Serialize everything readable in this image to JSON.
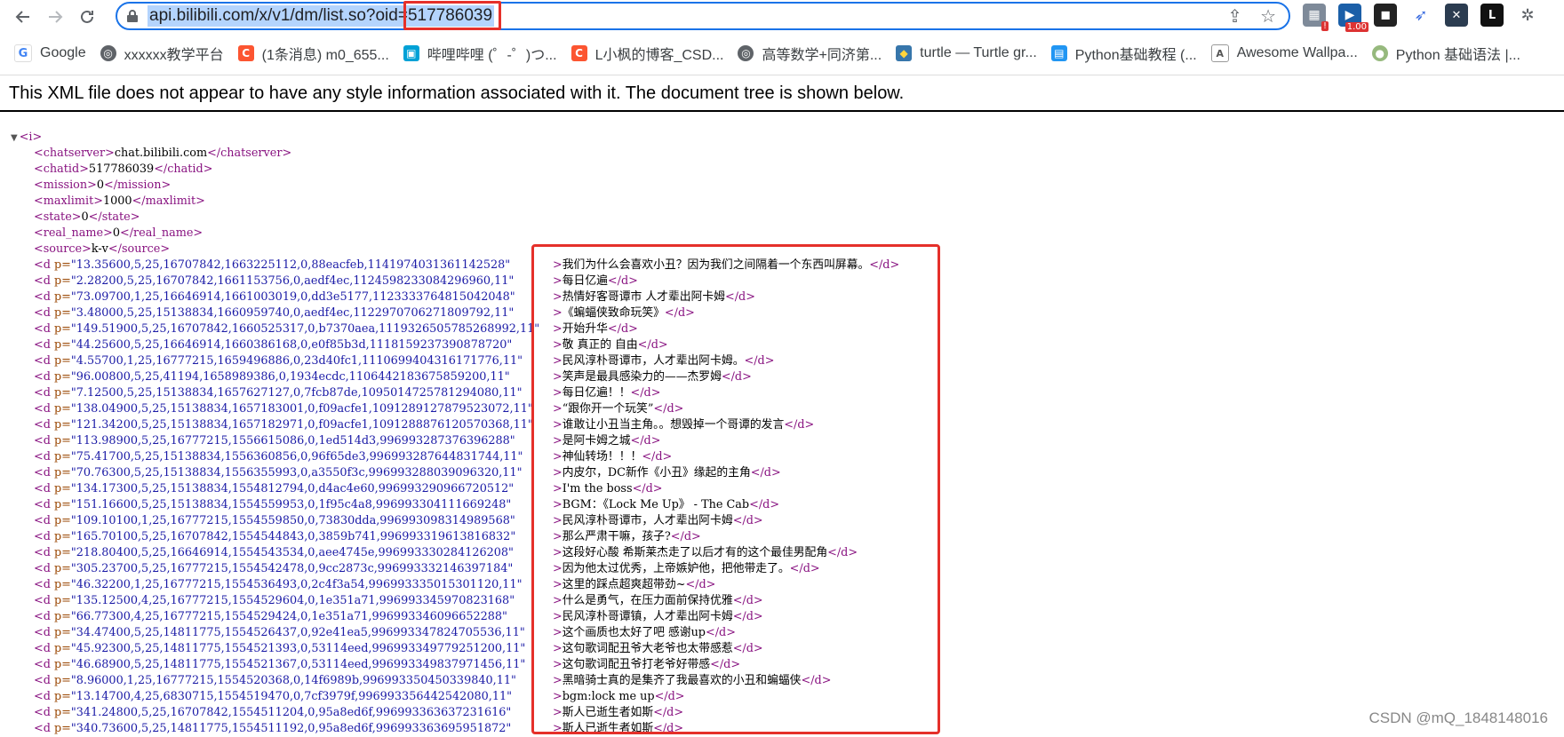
{
  "browser": {
    "url_base": "api.bilibili.com/x/v1/dm/list.so?oid=",
    "url_oid": "517786039",
    "extension_badges": [
      "!",
      "1.00"
    ],
    "bookmarks": [
      {
        "label": "Google",
        "icon": "google-icon",
        "color": "#4285f4"
      },
      {
        "label": "xxxxxx教学平台",
        "icon": "globe-icon",
        "color": "#5f6368"
      },
      {
        "label": "(1条消息) m0_655...",
        "icon": "csdn-icon",
        "color": "#fc5531"
      },
      {
        "label": "哔哩哔哩 (゜-゜)つ...",
        "icon": "bilibili-icon",
        "color": "#00a1d6"
      },
      {
        "label": "L小枫的博客_CSD...",
        "icon": "csdn-icon",
        "color": "#fc5531"
      },
      {
        "label": "高等数学+同济第...",
        "icon": "globe-icon",
        "color": "#5f6368"
      },
      {
        "label": "turtle — Turtle gr...",
        "icon": "python-icon",
        "color": "#3776ab"
      },
      {
        "label": "Python基础教程 (...",
        "icon": "runoob-icon",
        "color": "#2196f3"
      },
      {
        "label": "Awesome Wallpa...",
        "icon": "wallpaper-icon",
        "color": "#555555"
      },
      {
        "label": "Python 基础语法 |...",
        "icon": "runoob-green-icon",
        "color": "#96b97d"
      }
    ]
  },
  "xml": {
    "header": "This XML file does not appear to have any style information associated with it. The document tree is shown below.",
    "root_open": "<i>",
    "meta": [
      {
        "tag": "chatserver",
        "value": "chat.bilibili.com"
      },
      {
        "tag": "chatid",
        "value": "517786039"
      },
      {
        "tag": "mission",
        "value": "0"
      },
      {
        "tag": "maxlimit",
        "value": "1000"
      },
      {
        "tag": "state",
        "value": "0"
      },
      {
        "tag": "real_name",
        "value": "0"
      },
      {
        "tag": "source",
        "value": "k-v"
      }
    ],
    "danmaku": [
      {
        "p": "13.35600,5,25,16707842,1663225112,0,88eacfeb,1141974031361142528",
        "text": "我们为什么会喜欢小丑？因为我们之间隔着一个东西叫屏幕。"
      },
      {
        "p": "2.28200,5,25,16707842,1661153756,0,aedf4ec,1124598233084296960,11",
        "text": "每日亿遍"
      },
      {
        "p": "73.09700,1,25,16646914,1661003019,0,dd3e5177,1123333764815042048",
        "text": "热情好客哥谭市 人才辈出阿卡姆"
      },
      {
        "p": "3.48000,5,25,15138834,1660959740,0,aedf4ec,1122970706271809792,11",
        "text": "《蝙蝠侠致命玩笑》"
      },
      {
        "p": "149.51900,5,25,16707842,1660525317,0,b7370aea,1119326505785268992,11",
        "text": "开始升华"
      },
      {
        "p": "44.25600,5,25,16646914,1660386168,0,e0f85b3d,1118159237390878720",
        "text": "敬 真正的 自由"
      },
      {
        "p": "4.55700,1,25,16777215,1659496886,0,23d40fc1,1110699404316171776,11",
        "text": "民风淳朴哥谭市，人才辈出阿卡姆。"
      },
      {
        "p": "96.00800,5,25,41194,1658989386,0,1934ecdc,1106442183675859200,11",
        "text": "笑声是最具感染力的——杰罗姆"
      },
      {
        "p": "7.12500,5,25,15138834,1657627127,0,7fcb87de,1095014725781294080,11",
        "text": "每日亿遍！！"
      },
      {
        "p": "138.04900,5,25,15138834,1657183001,0,f09acfe1,1091289127879523072,11",
        "text": "“跟你开一个玩笑”"
      },
      {
        "p": "121.34200,5,25,15138834,1657182971,0,f09acfe1,1091288876120570368,11",
        "text": "谁敢让小丑当主角。。想毁掉一个哥谭的发言"
      },
      {
        "p": "113.98900,5,25,16777215,1556615086,0,1ed514d3,996993287376396288",
        "text": "是阿卡姆之城"
      },
      {
        "p": "75.41700,5,25,15138834,1556360856,0,96f65de3,996993287644831744,11",
        "text": "神仙转场！！！"
      },
      {
        "p": "70.76300,5,25,15138834,1556355993,0,a3550f3c,996993288039096320,11",
        "text": "内皮尔，DC新作《小丑》缘起的主角"
      },
      {
        "p": "134.17300,5,25,15138834,1554812794,0,d4ac4e60,996993290966720512",
        "text": "I'm the boss"
      },
      {
        "p": "151.16600,5,25,15138834,1554559953,0,1f95c4a8,996993304111669248",
        "text": "BGM：《Lock Me Up》 - The Cab"
      },
      {
        "p": "109.10100,1,25,16777215,1554559850,0,73830dda,996993098314989568",
        "text": "民风淳朴哥谭市，人才辈出阿卡姆"
      },
      {
        "p": "165.70100,5,25,16707842,1554544843,0,3859b741,996993319613816832",
        "text": "那么严肃干嘛，孩子?"
      },
      {
        "p": "218.80400,5,25,16646914,1554543534,0,aee4745e,996993330284126208",
        "text": "这段好心酸 希斯莱杰走了以后才有的这个最佳男配角"
      },
      {
        "p": "305.23700,5,25,16777215,1554542478,0,9cc2873c,996993332146397184",
        "text": "因为他太过优秀，上帝嫉妒他，把他带走了。"
      },
      {
        "p": "46.32200,1,25,16777215,1554536493,0,2c4f3a54,996993335015301120,11",
        "text": "这里的踩点超爽超带劲~"
      },
      {
        "p": "135.12500,4,25,16777215,1554529604,0,1e351a71,996993345970823168",
        "text": "什么是勇气，在压力面前保持优雅"
      },
      {
        "p": "66.77300,4,25,16777215,1554529424,0,1e351a71,996993346096652288",
        "text": "民风淳朴哥谭镇，人才辈出阿卡姆"
      },
      {
        "p": "34.47400,5,25,14811775,1554526437,0,92e41ea5,996993347824705536,11",
        "text": "这个画质也太好了吧 感谢up"
      },
      {
        "p": "45.92300,5,25,14811775,1554521393,0,53114eed,996993349779251200,11",
        "text": "这句歌词配丑爷大老爷也太带感惹"
      },
      {
        "p": "46.68900,5,25,14811775,1554521367,0,53114eed,996993349837971456,11",
        "text": "这句歌词配丑爷打老爷好带感"
      },
      {
        "p": "8.96000,1,25,16777215,1554520368,0,14f6989b,996993350450339840,11",
        "text": "黑暗骑士真的是集齐了我最喜欢的小丑和蝙蝠侠"
      },
      {
        "p": "13.14700,4,25,6830715,1554519470,0,7cf3979f,996993356442542080,11",
        "text": "bgm:lock me up"
      },
      {
        "p": "341.24800,5,25,16707842,1554511204,0,95a8ed6f,996993363637231616",
        "text": "斯人已逝生者如斯"
      },
      {
        "p": "340.73600,5,25,14811775,1554511192,0,95a8ed6f,996993363695951872",
        "text": "斯人已逝生者如斯"
      }
    ]
  },
  "watermark": "CSDN @mQ_1848148016"
}
